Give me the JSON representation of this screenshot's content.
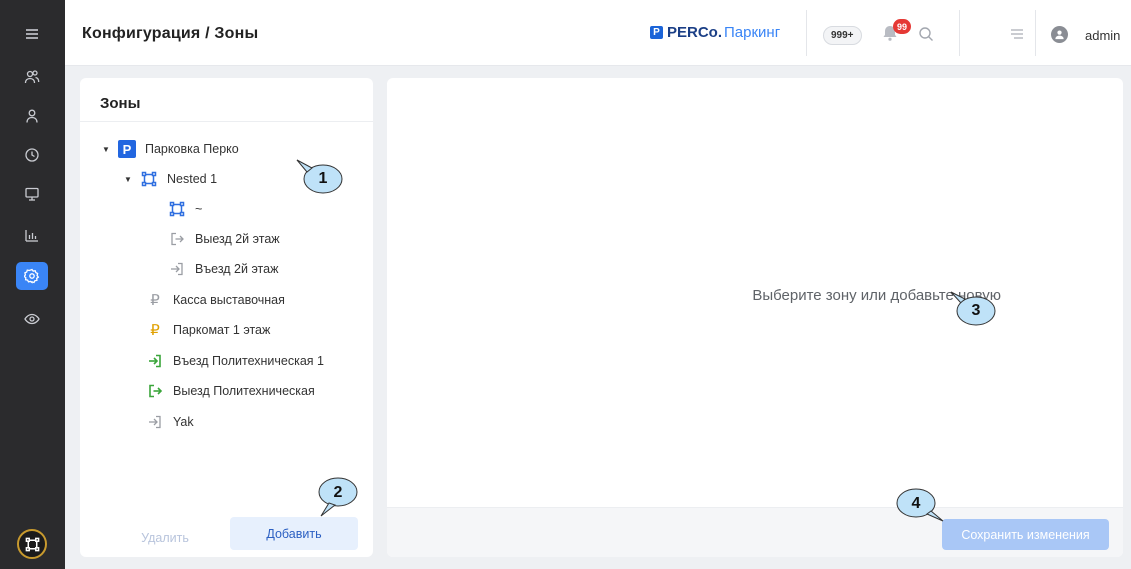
{
  "header": {
    "title": "Конфигурация / Зоны",
    "brand_mark": "P",
    "brand_name": "PERCo.",
    "brand_sub": "Паркинг",
    "count_badge": "999+",
    "notifications_badge": "99",
    "user_name": "admin",
    "icons": [
      "bell-icon",
      "search-icon",
      "menu-lines-icon",
      "user-avatar-icon"
    ]
  },
  "sidebar": {
    "items": [
      {
        "name": "menu",
        "icon": "hamburger-icon"
      },
      {
        "name": "users-groups",
        "icon": "users-icon"
      },
      {
        "name": "user",
        "icon": "user-icon"
      },
      {
        "name": "history",
        "icon": "clock-icon"
      },
      {
        "name": "monitor",
        "icon": "monitor-icon"
      },
      {
        "name": "reports",
        "icon": "bar-chart-icon"
      },
      {
        "name": "configuration",
        "icon": "gear-icon",
        "active": true
      },
      {
        "name": "view",
        "icon": "eye-icon"
      }
    ],
    "bottom_icon": "zone-icon"
  },
  "zones_panel": {
    "title": "Зоны",
    "tree": [
      {
        "label": "Парковка Перко",
        "icon": "parking-icon",
        "badge": "P"
      },
      {
        "label": "Nested 1",
        "icon": "zone-icon"
      },
      {
        "label": "~",
        "icon": "zone-icon"
      },
      {
        "label": "Выезд 2й этаж",
        "icon": "exit-icon"
      },
      {
        "label": "Въезд 2й этаж",
        "icon": "entry-icon"
      },
      {
        "label": "Касса выставочная",
        "icon": "ruble-icon",
        "glyph": "₽"
      },
      {
        "label": "Паркомат 1 этаж",
        "icon": "ruble-icon",
        "glyph": "₽"
      },
      {
        "label": "Въезд Политехническая 1",
        "icon": "entry-icon"
      },
      {
        "label": "Выезд Политехническая",
        "icon": "exit-icon"
      },
      {
        "label": "Yak",
        "icon": "entry-icon"
      }
    ],
    "delete_label": "Удалить",
    "add_label": "Добавить"
  },
  "details_panel": {
    "empty_message": "Выберите зону или добавьте новую",
    "save_label": "Сохранить изменения"
  },
  "callouts": [
    "1",
    "2",
    "3",
    "4"
  ],
  "colors": {
    "sidebar_bg": "#2b2b2d",
    "accent": "#3a85f6",
    "content_bg": "#eef0f3",
    "zone_blue": "#2f6fe0",
    "ruble_gold": "#e0a000",
    "entry_green": "#3aa53a",
    "muted_gray": "#9a9da3",
    "callout_fill": "#bfe2f8"
  }
}
